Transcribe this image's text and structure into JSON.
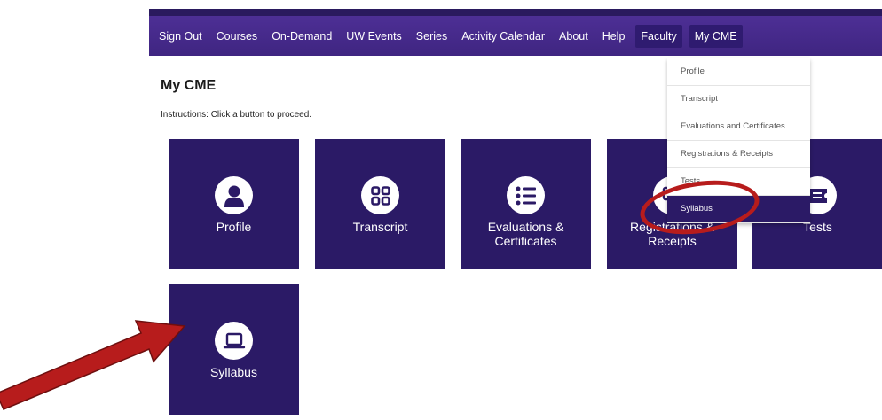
{
  "navbar": {
    "items": [
      {
        "label": "Sign Out"
      },
      {
        "label": "Courses"
      },
      {
        "label": "On-Demand"
      },
      {
        "label": "UW Events"
      },
      {
        "label": "Series"
      },
      {
        "label": "Activity Calendar"
      },
      {
        "label": "About"
      },
      {
        "label": "Help"
      },
      {
        "label": "Faculty"
      },
      {
        "label": "My CME"
      }
    ]
  },
  "page": {
    "title": "My CME",
    "instructions": "Instructions: Click a button to proceed."
  },
  "tiles": [
    {
      "label": "Profile",
      "icon": "person-icon"
    },
    {
      "label": "Transcript",
      "icon": "grid-icon"
    },
    {
      "label_line1": "Evaluations &",
      "label_line2": "Certificates",
      "icon": "list-icon"
    },
    {
      "label_line1": "Registrations &",
      "label_line2": "Receipts",
      "icon": "monitor-icon"
    },
    {
      "label": "Tests",
      "icon": "ticket-icon"
    },
    {
      "label": "Syllabus",
      "icon": "laptop-icon"
    }
  ],
  "dropdown": {
    "items": [
      {
        "label": "Profile"
      },
      {
        "label": "Transcript"
      },
      {
        "label": "Evaluations and Certificates"
      },
      {
        "label": "Registrations & Receipts"
      },
      {
        "label": "Tests"
      },
      {
        "label": "Syllabus",
        "active": true
      }
    ]
  },
  "colors": {
    "nav_bg": "#4d2f95",
    "tile_bg": "#2b1a66",
    "annotation_red": "#b71c1c"
  }
}
